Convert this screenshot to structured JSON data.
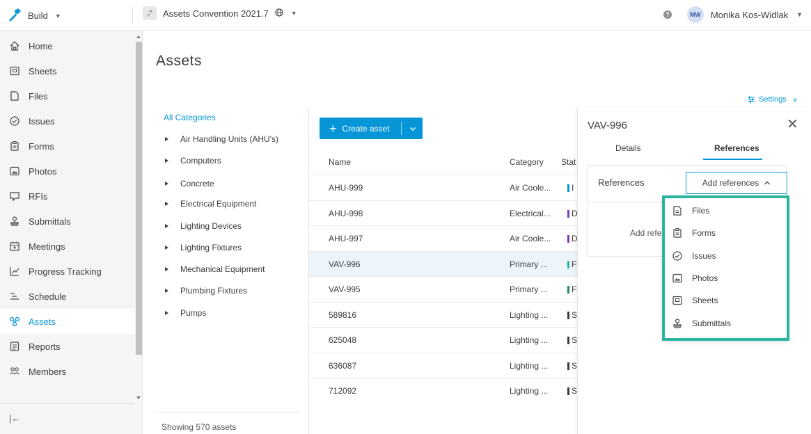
{
  "topbar": {
    "product_label": "Build",
    "project_label": "Assets Convention 2021.7",
    "user_initials": "MW",
    "user_name": "Monika Kos-Widlak"
  },
  "nav": {
    "items": [
      {
        "label": "Home",
        "icon": "home-icon"
      },
      {
        "label": "Sheets",
        "icon": "sheets-icon"
      },
      {
        "label": "Files",
        "icon": "files-icon"
      },
      {
        "label": "Issues",
        "icon": "issues-icon"
      },
      {
        "label": "Forms",
        "icon": "forms-icon"
      },
      {
        "label": "Photos",
        "icon": "photos-icon"
      },
      {
        "label": "RFIs",
        "icon": "rfis-icon"
      },
      {
        "label": "Submittals",
        "icon": "submittals-icon"
      },
      {
        "label": "Meetings",
        "icon": "meetings-icon"
      },
      {
        "label": "Progress Tracking",
        "icon": "progress-tracking-icon"
      },
      {
        "label": "Schedule",
        "icon": "schedule-icon"
      },
      {
        "label": "Assets",
        "icon": "assets-icon",
        "active": true
      },
      {
        "label": "Reports",
        "icon": "reports-icon"
      },
      {
        "label": "Members",
        "icon": "members-icon"
      }
    ],
    "collapse_icon": "collapse-icon"
  },
  "page": {
    "title": "Assets",
    "settings_label": "Settings"
  },
  "categories": {
    "all_label": "All Categories",
    "items": [
      "Air Handling Units (AHU's)",
      "Computers",
      "Concrete",
      "Electrical Equipment",
      "Lighting Devices",
      "Lighting Fixtures",
      "Mechanical Equipment",
      "Plumbing Fixtures",
      "Pumps"
    ],
    "footer": "Showing 570 assets"
  },
  "toolbar": {
    "create_label": "Create asset"
  },
  "table": {
    "headers": {
      "name": "Name",
      "category": "Category",
      "status": "Stat"
    },
    "rows": [
      {
        "name": "AHU-999",
        "category": "Air Coole...",
        "status": "I",
        "status_color": "#0696d7"
      },
      {
        "name": "AHU-998",
        "category": "Electrical...",
        "status": "D",
        "status_color": "#7a3fbf"
      },
      {
        "name": "AHU-997",
        "category": "Air Coole...",
        "status": "D",
        "status_color": "#7a3fbf"
      },
      {
        "name": "VAV-996",
        "category": "Primary ...",
        "status": "F",
        "status_color": "#2bb4a0",
        "selected": true
      },
      {
        "name": "VAV-995",
        "category": "Primary ...",
        "status": "F",
        "status_color": "#1f8a60"
      },
      {
        "name": "589816",
        "category": "Lighting ...",
        "status": "S",
        "status_color": "#3c3c3c"
      },
      {
        "name": "625048",
        "category": "Lighting ...",
        "status": "S",
        "status_color": "#3c3c3c"
      },
      {
        "name": "636087",
        "category": "Lighting ...",
        "status": "S",
        "status_color": "#3c3c3c"
      },
      {
        "name": "712092",
        "category": "Lighting ...",
        "status": "S",
        "status_color": "#3c3c3c"
      }
    ]
  },
  "panel": {
    "title": "VAV-996",
    "tabs": {
      "details": "Details",
      "references": "References"
    },
    "references_label": "References",
    "add_references_label": "Add references",
    "empty_text": "Add refe"
  },
  "dropdown": {
    "items": [
      {
        "label": "Files",
        "icon": "files-icon"
      },
      {
        "label": "Forms",
        "icon": "forms-icon"
      },
      {
        "label": "Issues",
        "icon": "issues-icon"
      },
      {
        "label": "Photos",
        "icon": "photos-icon"
      },
      {
        "label": "Sheets",
        "icon": "sheets-icon"
      },
      {
        "label": "Submittals",
        "icon": "submittals-icon"
      }
    ],
    "highlight_color": "#2bb4a0"
  },
  "colors": {
    "accent": "#0696d7",
    "highlight": "#2bb4a0"
  }
}
